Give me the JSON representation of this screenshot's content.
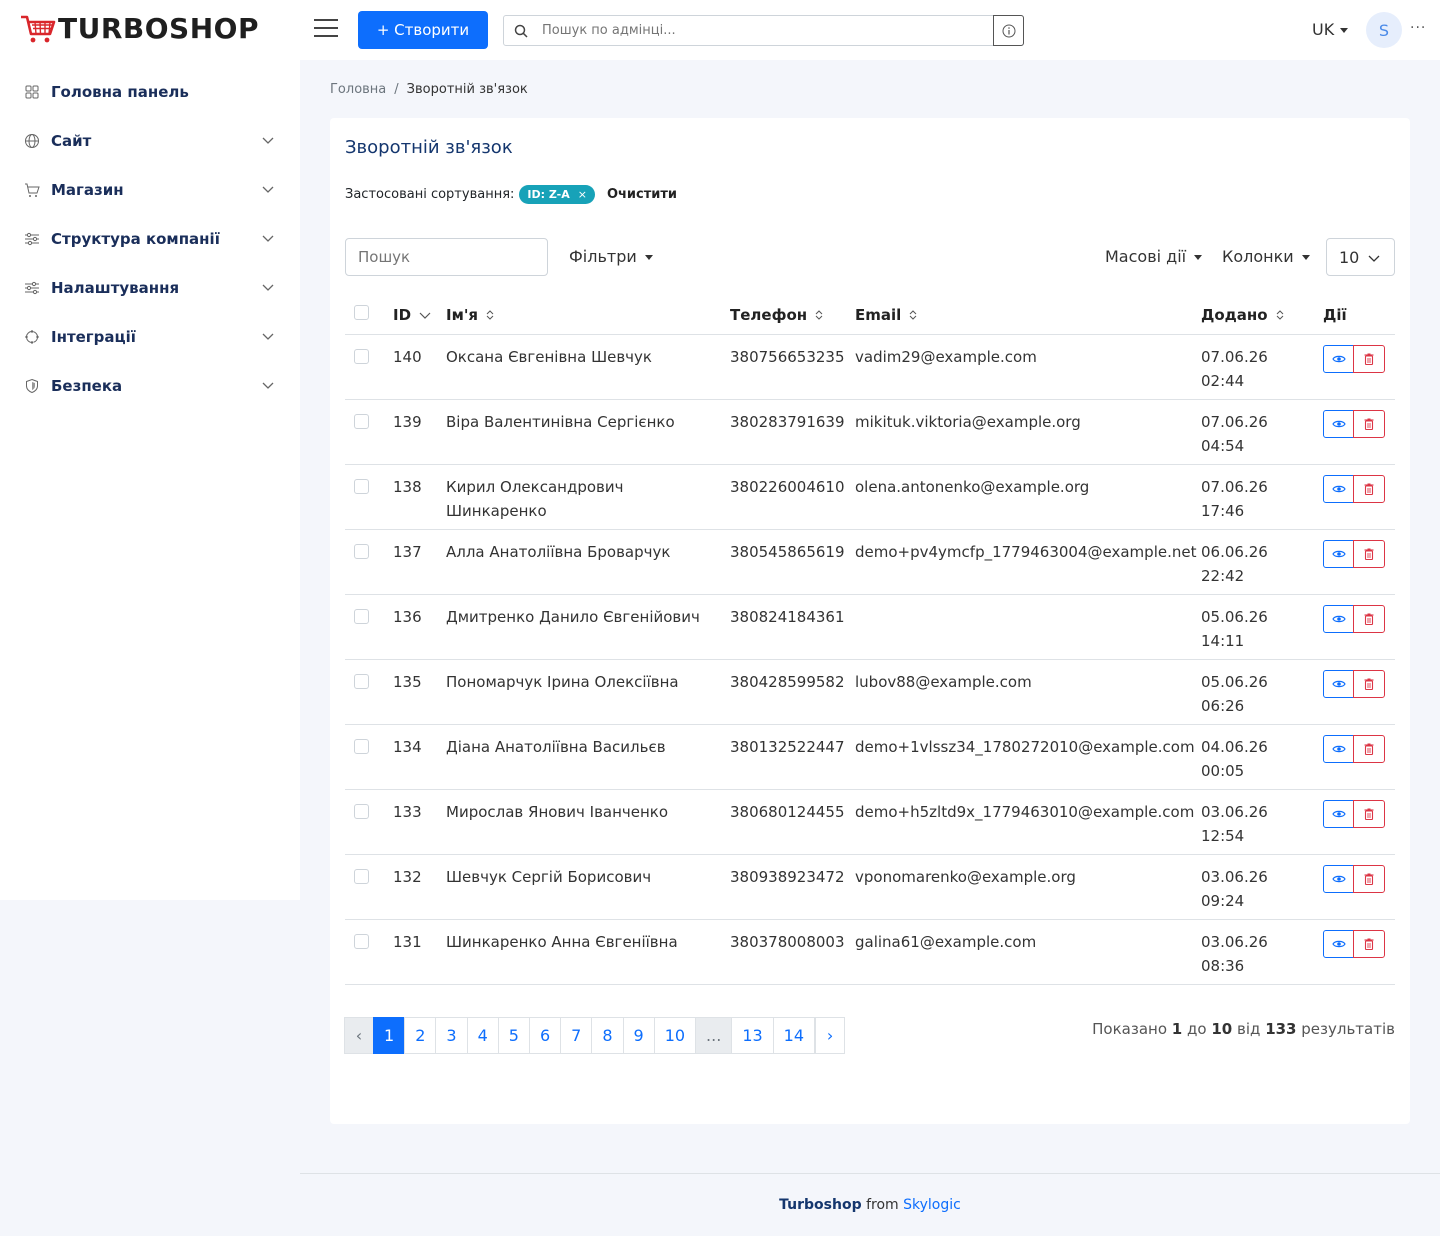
{
  "header": {
    "logo_text": "TURBOSHOP",
    "create_label": "+ Створити",
    "search_placeholder": "Пошук по адмінці...",
    "lang": "UK",
    "avatar_letter": "S",
    "more": "···"
  },
  "sidebar": {
    "items": [
      {
        "label": "Головна панель",
        "icon": "dashboard-icon"
      },
      {
        "label": "Сайт",
        "icon": "globe-icon"
      },
      {
        "label": "Магазин",
        "icon": "cart-icon"
      },
      {
        "label": "Структура компанії",
        "icon": "sliders-icon"
      },
      {
        "label": "Налаштування",
        "icon": "settings-icon"
      },
      {
        "label": "Інтеграції",
        "icon": "integrations-icon"
      },
      {
        "label": "Безпека",
        "icon": "shield-icon"
      }
    ]
  },
  "breadcrumb": {
    "home": "Головна",
    "sep": "/",
    "current": "Зворотній зв'язок"
  },
  "card": {
    "title": "Зворотній зв'язок",
    "sorting_label": "Застосовані сортування:",
    "sorting_badge": "ID: Z-A",
    "sorting_badge_x": "×",
    "clear_label": "Очистити",
    "search_placeholder": "Пошук",
    "filters_label": "Фільтри",
    "bulk_label": "Масові дії",
    "columns_label": "Колонки",
    "per_page": "10"
  },
  "table": {
    "headers": {
      "id": "ID",
      "name": "Ім'я",
      "phone": "Телефон",
      "email": "Email",
      "added": "Додано",
      "actions": "Дії"
    },
    "rows": [
      {
        "id": "140",
        "name": "Оксана Євгенівна Шевчук",
        "phone": "380756653235",
        "email": "vadim29@example.com",
        "date": "07.06.26",
        "time": "02:44"
      },
      {
        "id": "139",
        "name": "Віра Валентинівна Сергієнко",
        "phone": "380283791639",
        "email": "mikituk.viktoria@example.org",
        "date": "07.06.26",
        "time": "04:54"
      },
      {
        "id": "138",
        "name": "Кирил Олександрович Шинкаренко",
        "phone": "380226004610",
        "email": "olena.antonenko@example.org",
        "date": "07.06.26",
        "time": "17:46"
      },
      {
        "id": "137",
        "name": "Алла Анатоліївна Броварчук",
        "phone": "380545865619",
        "email": "demo+pv4ymcfp_1779463004@example.net",
        "date": "06.06.26",
        "time": "22:42"
      },
      {
        "id": "136",
        "name": "Дмитренко Данило Євгенійович",
        "phone": "380824184361",
        "email": "",
        "date": "05.06.26",
        "time": "14:11"
      },
      {
        "id": "135",
        "name": "Пономарчук Ірина Олексіївна",
        "phone": "380428599582",
        "email": "lubov88@example.com",
        "date": "05.06.26",
        "time": "06:26"
      },
      {
        "id": "134",
        "name": "Діана Анатоліївна Васильєв",
        "phone": "380132522447",
        "email": "demo+1vlssz34_1780272010@example.com",
        "date": "04.06.26",
        "time": "00:05"
      },
      {
        "id": "133",
        "name": "Мирослав Янович Іванченко",
        "phone": "380680124455",
        "email": "demo+h5zltd9x_1779463010@example.com",
        "date": "03.06.26",
        "time": "12:54"
      },
      {
        "id": "132",
        "name": "Шевчук Сергій Борисович",
        "phone": "380938923472",
        "email": "vponomarenko@example.org",
        "date": "03.06.26",
        "time": "09:24"
      },
      {
        "id": "131",
        "name": "Шинкаренко Анна Євгеніївна",
        "phone": "380378008003",
        "email": "galina61@example.com",
        "date": "03.06.26",
        "time": "08:36"
      }
    ]
  },
  "pagination": {
    "prev": "‹",
    "pages": [
      "1",
      "2",
      "3",
      "4",
      "5",
      "6",
      "7",
      "8",
      "9",
      "10"
    ],
    "ellipsis": "...",
    "last_pages": [
      "13",
      "14"
    ],
    "next": "›",
    "active": "1"
  },
  "results": {
    "prefix": "Показано",
    "from": "1",
    "to_word": "до",
    "to": "10",
    "of_word": "від",
    "total": "133",
    "suffix": "результатів"
  },
  "footer": {
    "brand": "Turboshop",
    "from": "from",
    "company": "Skylogic"
  },
  "colors": {
    "primary": "#0d6efd",
    "danger": "#dc3545",
    "badge": "#17a2b8",
    "title": "#14366e"
  }
}
